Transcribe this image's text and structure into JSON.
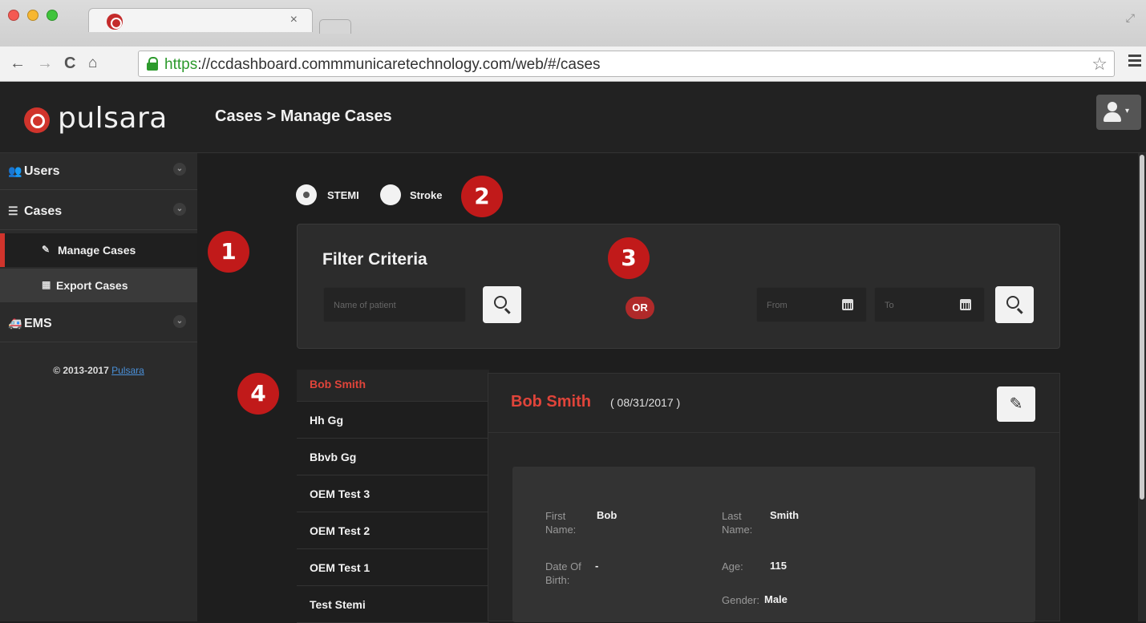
{
  "browser": {
    "url_scheme": "https",
    "url_rest": "://ccdashboard.commmunicaretechnology.com/web/#/cases",
    "tab_close": "×"
  },
  "sidebar": {
    "brand": "pulsara",
    "groups": [
      {
        "label": "Users",
        "icon": "users-icon"
      },
      {
        "label": "Cases",
        "icon": "list-icon"
      },
      {
        "label": "EMS",
        "icon": "ambulance-icon"
      }
    ],
    "subitems": [
      {
        "label": "Manage Cases",
        "icon": "edit-icon",
        "active": true
      },
      {
        "label": "Export Cases",
        "icon": "table-icon",
        "active": false
      }
    ],
    "copyright_text": "© 2013-2017 ",
    "copyright_link": "Pulsara"
  },
  "header": {
    "title": "Cases > Manage Cases"
  },
  "case_type": {
    "options": [
      {
        "label": "STEMI",
        "checked": true
      },
      {
        "label": "Stroke",
        "checked": false
      }
    ]
  },
  "filter": {
    "title": "Filter Criteria",
    "name_placeholder": "Name of patient",
    "or_label": "OR",
    "from_placeholder": "From",
    "to_placeholder": "To"
  },
  "annotations": [
    "1",
    "2",
    "3",
    "4"
  ],
  "patients": [
    "Bob Smith",
    "Hh Gg",
    "Bbvb Gg",
    "OEM Test 3",
    "OEM Test 2",
    "OEM Test 1",
    "Test Stemi"
  ],
  "detail": {
    "name": "Bob Smith",
    "date": "( 08/31/2017 )",
    "fields": {
      "first_name_label": "First Name:",
      "first_name": "Bob",
      "last_name_label": "Last Name:",
      "last_name": "Smith",
      "dob_label": "Date Of Birth:",
      "dob": "-",
      "age_label": "Age:",
      "age": "115",
      "gender_label": "Gender:",
      "gender": "Male"
    }
  },
  "colors": {
    "accent": "#d0342c",
    "patient_name": "#e0443a",
    "badge": "#c11a1a"
  }
}
